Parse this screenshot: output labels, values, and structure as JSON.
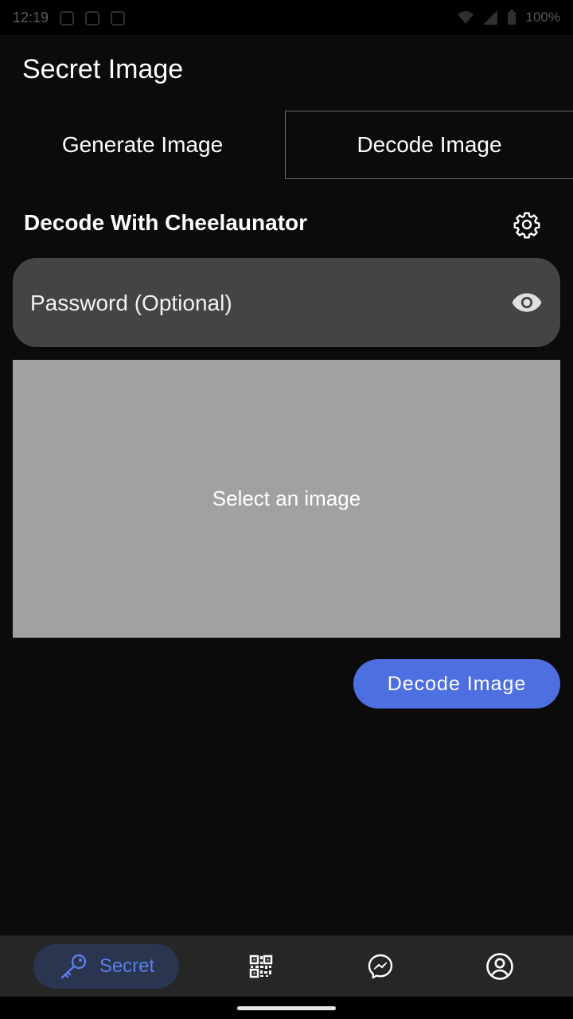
{
  "status_bar": {
    "time": "12:19",
    "battery_text": "100%"
  },
  "app": {
    "title": "Secret Image"
  },
  "tabs": [
    {
      "label": "Generate Image",
      "selected": false
    },
    {
      "label": "Decode Image",
      "selected": true
    }
  ],
  "decode": {
    "section_title": "Decode With Cheelaunator",
    "settings_icon": "gear-icon",
    "password": {
      "value": "",
      "placeholder": "Password (Optional)",
      "visibility_icon": "eye-icon"
    },
    "image_picker_label": "Select an image",
    "decode_button_label": "Decode Image"
  },
  "bottom_nav": {
    "items": [
      {
        "label": "Secret",
        "icon": "key-icon",
        "active": true
      },
      {
        "label": "",
        "icon": "qr-code-icon",
        "active": false
      },
      {
        "label": "",
        "icon": "messenger-icon",
        "active": false
      },
      {
        "label": "",
        "icon": "account-circle-icon",
        "active": false
      }
    ]
  },
  "colors": {
    "background": "#0b0b0b",
    "accent": "#4d6fe0",
    "field_background": "#444444",
    "image_placeholder": "#a1a1a1",
    "nav_background": "#262626",
    "nav_active_pill": "#2a3550",
    "nav_active_text": "#5a7de8"
  }
}
